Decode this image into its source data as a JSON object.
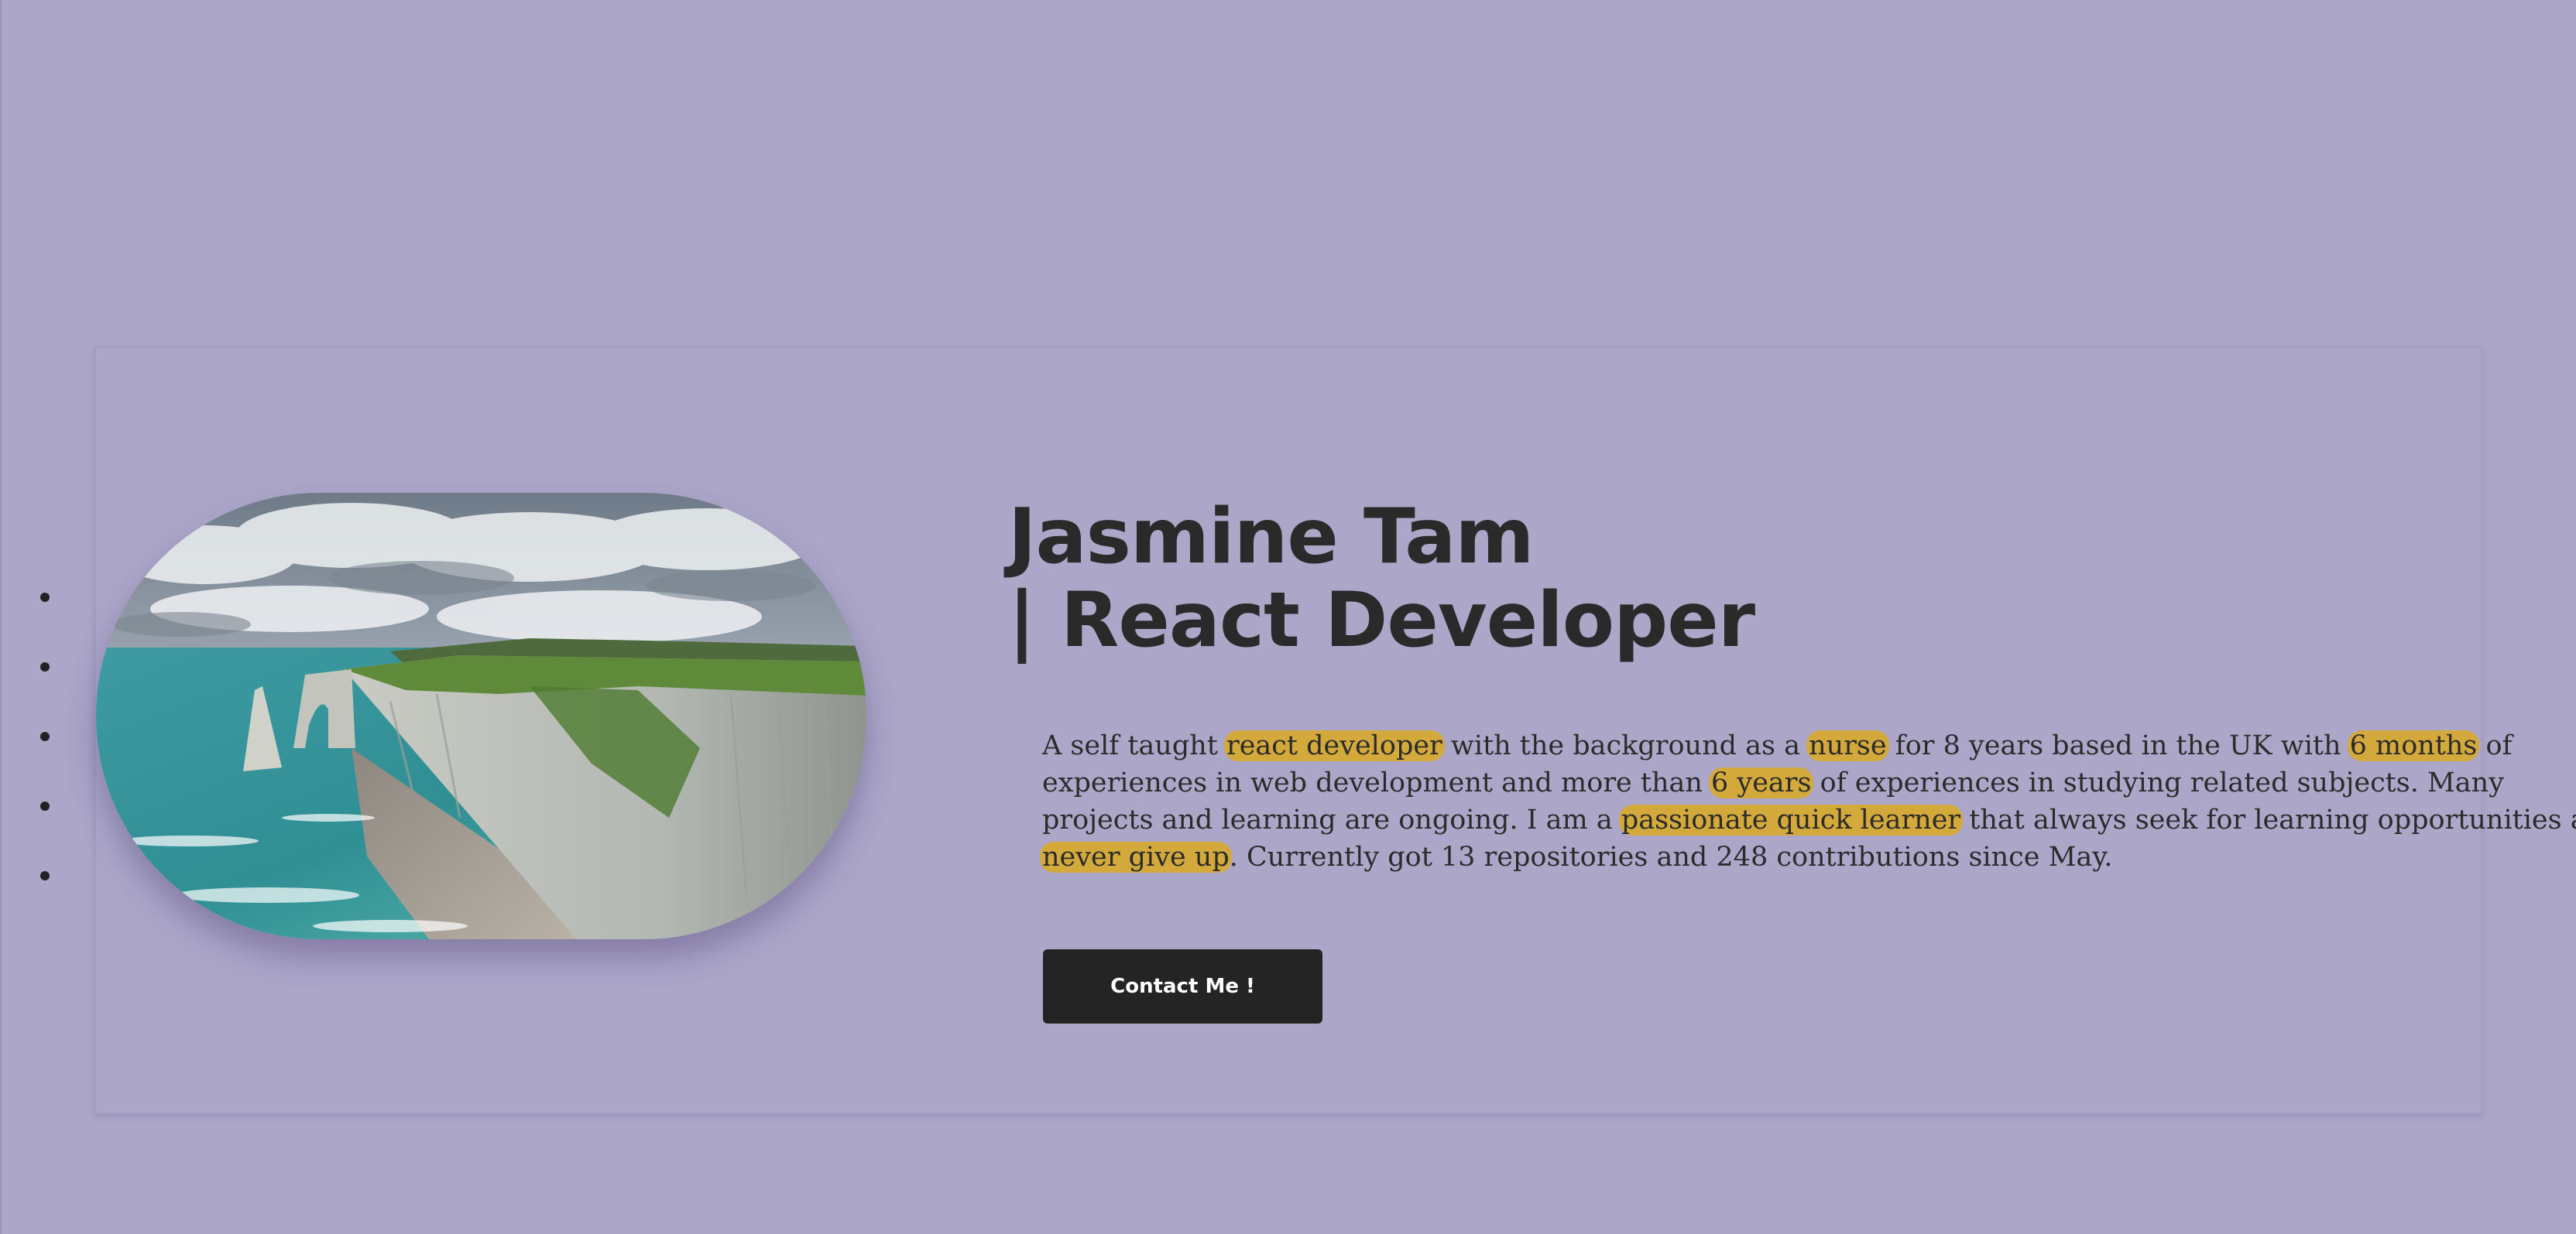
{
  "side_nav": {
    "dots": [
      "",
      "",
      "",
      "",
      ""
    ]
  },
  "hero": {
    "image_icon": "landscape-photo-icon",
    "title_line1": "Jasmine Tam",
    "title_line2": "| React Developer"
  },
  "bio": {
    "lines": [
      [
        {
          "text": "A self taught ",
          "hl": false
        },
        {
          "text": "react developer",
          "hl": true
        },
        {
          "text": " with the background as a ",
          "hl": false
        },
        {
          "text": "nurse",
          "hl": true
        },
        {
          "text": " for 8 years based in the UK with ",
          "hl": false
        },
        {
          "text": "6 months",
          "hl": true
        },
        {
          "text": " of",
          "hl": false
        }
      ],
      [
        {
          "text": "experiences in web development and more than ",
          "hl": false
        },
        {
          "text": "6 years",
          "hl": true
        },
        {
          "text": " of experiences in studying related subjects. Many",
          "hl": false
        }
      ],
      [
        {
          "text": "projects and learning are ongoing. I am a ",
          "hl": false
        },
        {
          "text": "passionate quick learner",
          "hl": true
        },
        {
          "text": " that always seek for learning opportunities and",
          "hl": false
        }
      ],
      [
        {
          "text": "never give up",
          "hl": true
        },
        {
          "text": ". Currently got 13 repositories and 248 contributions since May.",
          "hl": false
        }
      ]
    ]
  },
  "cta": {
    "label": "Contact Me !"
  },
  "colors": {
    "background": "#aca6c9",
    "highlight": "#d4a93c",
    "button": "#242424",
    "text": "#2a2a2a"
  }
}
